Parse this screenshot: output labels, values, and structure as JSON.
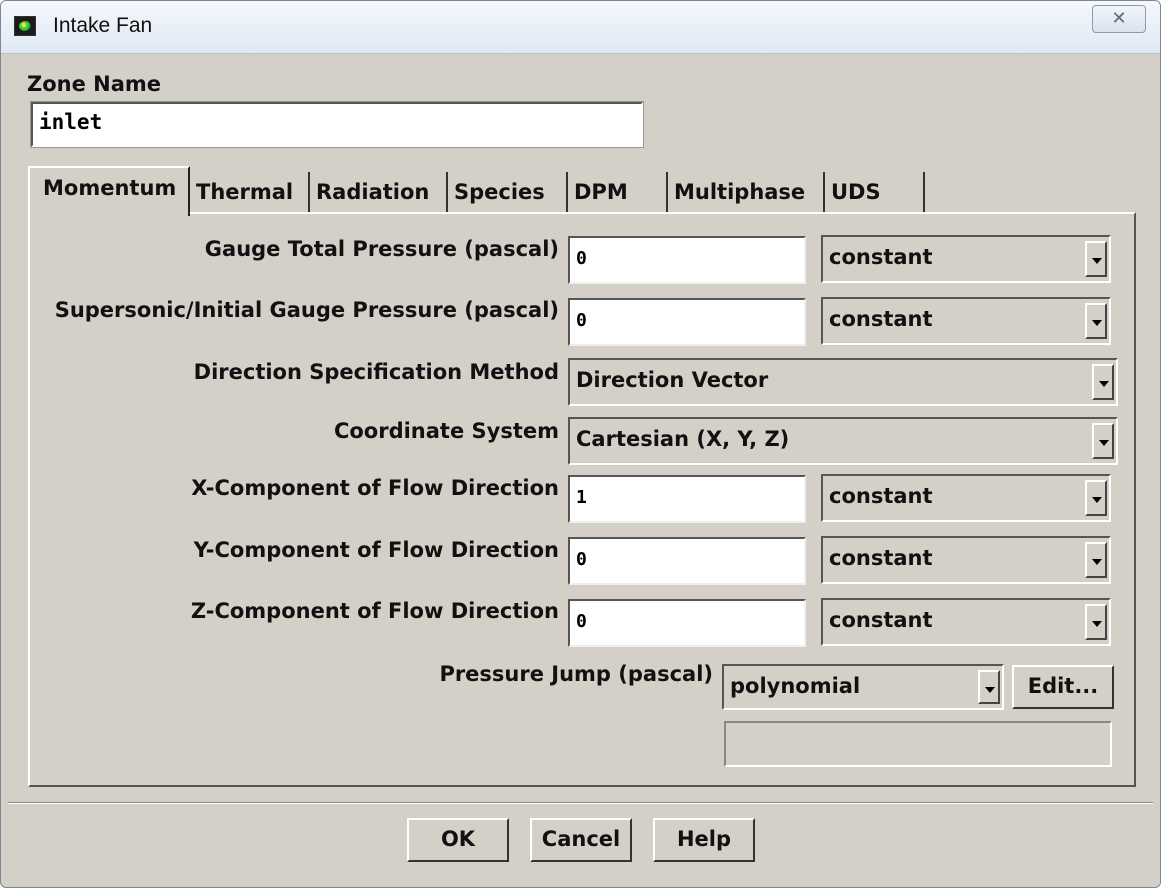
{
  "window": {
    "title": "Intake Fan",
    "close_glyph": "✕",
    "app_icon": "fluent-app-icon"
  },
  "zone": {
    "label": "Zone Name",
    "value": "inlet"
  },
  "tabs": [
    {
      "label": "Momentum",
      "active": true
    },
    {
      "label": "Thermal"
    },
    {
      "label": "Radiation"
    },
    {
      "label": "Species"
    },
    {
      "label": "DPM"
    },
    {
      "label": "Multiphase"
    },
    {
      "label": "UDS"
    }
  ],
  "momentum": {
    "gauge_total_pressure": {
      "label": "Gauge Total Pressure (pascal)",
      "value": "0",
      "method": "constant"
    },
    "supersonic_pressure": {
      "label": "Supersonic/Initial Gauge Pressure (pascal)",
      "value": "0",
      "method": "constant"
    },
    "direction_method": {
      "label": "Direction Specification Method",
      "value": "Direction Vector"
    },
    "coordinate_system": {
      "label": "Coordinate System",
      "value": "Cartesian (X, Y, Z)"
    },
    "x_component": {
      "label": "X-Component of Flow Direction",
      "value": "1",
      "method": "constant"
    },
    "y_component": {
      "label": "Y-Component of Flow Direction",
      "value": "0",
      "method": "constant"
    },
    "z_component": {
      "label": "Z-Component of Flow Direction",
      "value": "0",
      "method": "constant"
    },
    "pressure_jump": {
      "label": "Pressure Jump (pascal)",
      "value": "polynomial",
      "edit_label": "Edit..."
    }
  },
  "buttons": {
    "ok": "OK",
    "cancel": "Cancel",
    "help": "Help"
  }
}
